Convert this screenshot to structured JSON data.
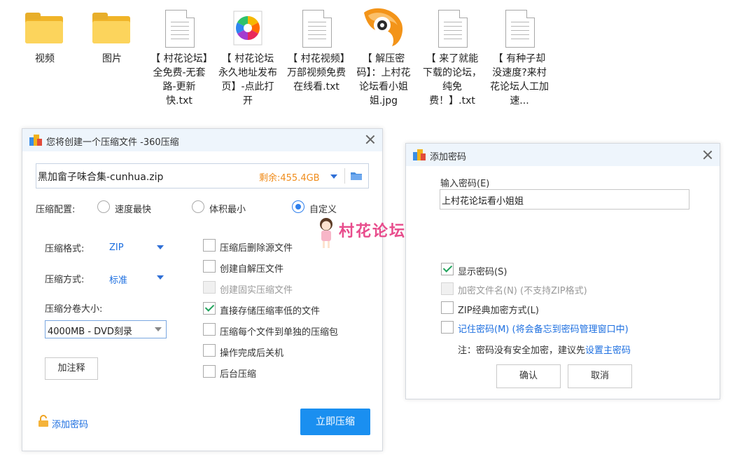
{
  "desktop": {
    "files": [
      {
        "type": "folder",
        "label": "视频"
      },
      {
        "type": "folder",
        "label": "图片"
      },
      {
        "type": "txt",
        "label": "【 村花论坛】全免费-无套路-更新快.txt"
      },
      {
        "type": "pinwheel",
        "label": "【 村花论坛永久地址发布页】-点此打开"
      },
      {
        "type": "txt",
        "label": "【 村花视频】万部视频免费在线看.txt"
      },
      {
        "type": "eye-app",
        "label": "【 解压密码】：上村花论坛看小姐姐.jpg"
      },
      {
        "type": "txt",
        "label": "【 来了就能下载的论坛，纯免费！】.txt"
      },
      {
        "type": "txt",
        "label": "【 有种子却没速度?来村花论坛人工加速..."
      }
    ]
  },
  "compress_dialog": {
    "title": "您将创建一个压缩文件 -360压缩",
    "filename": "黑加畲子味合集-cunhua.zip",
    "free_space": "剩余:455.4GB",
    "config_label": "压缩配置:",
    "config_options": [
      "速度最快",
      "体积最小",
      "自定义"
    ],
    "config_selected": "自定义",
    "format_label": "压缩格式:",
    "format_value": "ZIP",
    "method_label": "压缩方式:",
    "method_value": "标准",
    "split_label": "压缩分卷大小:",
    "split_value": "4000MB  -  DVD刻录",
    "comment_button": "加注释",
    "options": [
      {
        "label": "压缩后删除源文件",
        "checked": false,
        "disabled": false
      },
      {
        "label": "创建自解压文件",
        "checked": false,
        "disabled": false
      },
      {
        "label": "创建固实压缩文件",
        "checked": false,
        "disabled": true
      },
      {
        "label": "直接存储压缩率低的文件",
        "checked": true,
        "disabled": false
      },
      {
        "label": "压缩每个文件到单独的压缩包",
        "checked": false,
        "disabled": false
      },
      {
        "label": "操作完成后关机",
        "checked": false,
        "disabled": false
      },
      {
        "label": "后台压缩",
        "checked": false,
        "disabled": false
      }
    ],
    "add_password_link": "添加密码",
    "start_button": "立即压缩"
  },
  "password_dialog": {
    "title": "添加密码",
    "input_label": "输入密码(E)",
    "password_value": "上村花论坛看小姐姐",
    "options": [
      {
        "label": "显示密码(S)",
        "checked": true,
        "disabled": false,
        "style": "normal"
      },
      {
        "label": "加密文件名(N) (不支持ZIP格式)",
        "checked": false,
        "disabled": true,
        "style": "gray"
      },
      {
        "label": "ZIP经典加密方式(L)",
        "checked": false,
        "disabled": false,
        "style": "normal"
      },
      {
        "label": "记住密码(M) (将会备忘到密码管理窗口中)",
        "checked": false,
        "disabled": false,
        "style": "blue"
      }
    ],
    "note_prefix": "注：密码没有安全加密，建议先",
    "note_link": "设置主密码",
    "ok_button": "确认",
    "cancel_button": "取消"
  },
  "watermark": "村花论坛",
  "colors": {
    "accent": "#1a8ff0",
    "link": "#1d6fe0",
    "orange": "#f08c1b",
    "watermark": "#e84c8c"
  }
}
